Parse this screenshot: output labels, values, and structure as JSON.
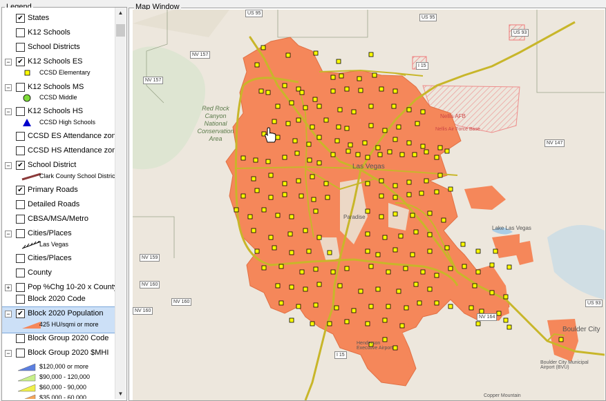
{
  "legend": {
    "title": "Legend",
    "rows": [
      {
        "label": "States",
        "checked": true,
        "expander": ""
      },
      {
        "label": "K12 Schools",
        "checked": false,
        "expander": ""
      },
      {
        "label": "School Districts",
        "checked": false,
        "expander": ""
      },
      {
        "label": "K12 Schools ES",
        "checked": true,
        "expander": "−",
        "sub": "CCSD Elementary"
      },
      {
        "label": "K12 Schools MS",
        "checked": false,
        "expander": "−",
        "sub": "CCSD Middle"
      },
      {
        "label": "K12 Schools HS",
        "checked": false,
        "expander": "−",
        "sub": "CCSD High Schools"
      },
      {
        "label": "CCSD ES Attendance zone",
        "checked": false,
        "expander": ""
      },
      {
        "label": "CCSD HS Attendance zone",
        "checked": false,
        "expander": ""
      },
      {
        "label": "School District",
        "checked": true,
        "expander": "−",
        "sub": "Clark County School District"
      },
      {
        "label": "Primary Roads",
        "checked": true,
        "expander": ""
      },
      {
        "label": "Detailed Roads",
        "checked": false,
        "expander": ""
      },
      {
        "label": "CBSA/MSA/Metro",
        "checked": false,
        "expander": ""
      },
      {
        "label": "Cities/Places",
        "checked": false,
        "expander": "−",
        "sub": "Las Vegas"
      },
      {
        "label": "Cities/Places",
        "checked": false,
        "expander": ""
      },
      {
        "label": "County",
        "checked": false,
        "expander": ""
      },
      {
        "label": "Pop %Chg 10-20 x County",
        "checked": false,
        "expander": "+"
      },
      {
        "label": "Block 2020 Code",
        "checked": false,
        "expander": ""
      },
      {
        "label": "Block 2020 Population",
        "checked": true,
        "expander": "−",
        "sub": "425 HU/sqmi or more",
        "selected": true
      },
      {
        "label": "Block Group 2020 Code",
        "checked": false,
        "expander": ""
      },
      {
        "label": "Block Group 2020 $MHI",
        "checked": false,
        "expander": "−"
      }
    ],
    "mhi_classes": [
      "$120,000 or more",
      "$90,000 - 120,000",
      "$60,000 - 90,000",
      "$35,000 - 60,000"
    ]
  },
  "map": {
    "title": "Map Window",
    "labels": {
      "red_rock": "Red Rock\nCanyon\nNational\nConservation\nArea",
      "nellis": "Nellis AFB",
      "nellis_base": "Nellis Air Force Base",
      "lake": "Lake Las Vegas",
      "boulder": "Boulder City",
      "henderson": "Henderson Executive Airport",
      "boulder_airport": "Boulder City Municipal Airport (BVU)",
      "copper": "Copper Mountain",
      "vegas": "Las Vegas",
      "paradise": "Paradise"
    },
    "shields": [
      "NV 157",
      "NV 157",
      "NV 159",
      "NV 160",
      "NV 160",
      "NV 160",
      "NV 147",
      "US 95",
      "US 95",
      "US 93",
      "US 93",
      "I 15",
      "I 15",
      "NV 164"
    ]
  },
  "colors": {
    "block": "#f5875a",
    "school": "#ffff00",
    "road": "#c8b62a",
    "accent": "#cce0f7"
  }
}
